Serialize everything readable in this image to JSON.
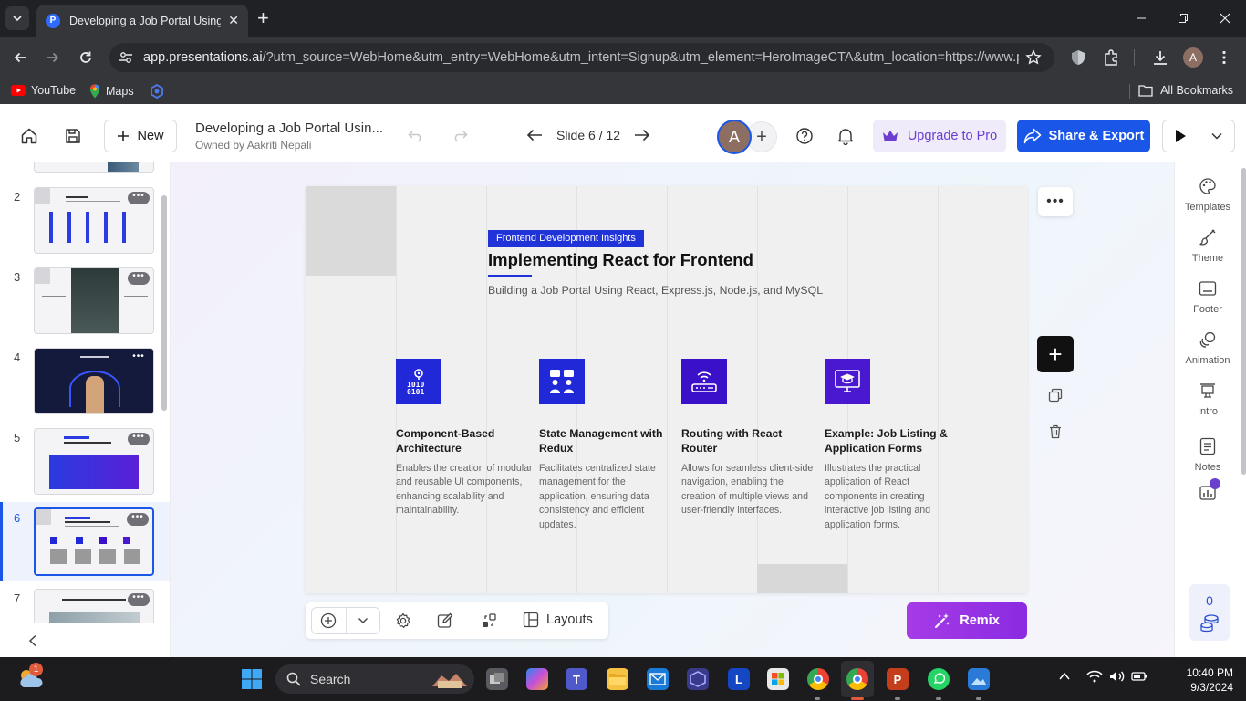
{
  "browser": {
    "tab_title": "Developing a Job Portal Using R",
    "url_host": "app.presentations.ai",
    "url_rest": "/?utm_source=WebHome&utm_entry=WebHome&utm_intent=Signup&utm_element=HeroImageCTA&utm_location=https://www.p...",
    "bookmarks": [
      {
        "label": "YouTube",
        "icon": "youtube-icon"
      },
      {
        "label": "Maps",
        "icon": "maps-icon"
      }
    ],
    "all_bookmarks": "All Bookmarks",
    "profile_initial": "A"
  },
  "header": {
    "new_label": "New",
    "doc_title": "Developing a Job Portal Usin...",
    "owner": "Owned by Aakriti Nepali",
    "slide_counter": "Slide 6 / 12",
    "avatar_initial": "A",
    "upgrade_label": "Upgrade to Pro",
    "share_label": "Share & Export"
  },
  "slide_panel": {
    "slides": [
      {
        "number": "2"
      },
      {
        "number": "3"
      },
      {
        "number": "4"
      },
      {
        "number": "5"
      },
      {
        "number": "6",
        "active": true
      },
      {
        "number": "7"
      }
    ]
  },
  "slide": {
    "tag": "Frontend Development Insights",
    "title": "Implementing React for Frontend",
    "subtitle": "Building a Job Portal Using React, Express.js, Node.js, and MySQL",
    "features": [
      {
        "heading": "Component-Based Architecture",
        "body": "Enables the creation of modular and reusable UI components, enhancing scalability and maintainability.",
        "icon": "binary-pin-icon",
        "color": "#2028d8"
      },
      {
        "heading": "State Management with Redux",
        "body": "Facilitates centralized state management for the application, ensuring data consistency and efficient updates.",
        "icon": "people-chat-icon",
        "color": "#2028d8"
      },
      {
        "heading": "Routing with React Router",
        "body": "Allows for seamless client-side navigation, enabling the creation of multiple views and user-friendly interfaces.",
        "icon": "router-icon",
        "color": "#3a10c8"
      },
      {
        "heading": "Example: Job Listing & Application Forms",
        "body": "Illustrates the practical application of React components in creating interactive job listing and application forms.",
        "icon": "graduation-monitor-icon",
        "color": "#4a18d0"
      }
    ]
  },
  "canvas_tools": {
    "layouts_label": "Layouts",
    "remix_label": "Remix"
  },
  "right_panel": {
    "tools": [
      {
        "label": "Templates",
        "icon": "palette-icon"
      },
      {
        "label": "Theme",
        "icon": "brush-icon"
      },
      {
        "label": "Footer",
        "icon": "footer-icon"
      },
      {
        "label": "Animation",
        "icon": "animation-icon"
      },
      {
        "label": "Intro",
        "icon": "intro-icon"
      },
      {
        "label": "Notes",
        "icon": "notes-icon"
      }
    ],
    "credits": "0"
  },
  "taskbar": {
    "search_label": "Search",
    "weather_badge": "1",
    "time": "10:40 PM",
    "date": "9/3/2024"
  },
  "colors": {
    "accent": "#1a56e8",
    "upgrade": "#6a3fd0",
    "remix": "#9a33e4",
    "slide_tag": "#2033d9"
  }
}
